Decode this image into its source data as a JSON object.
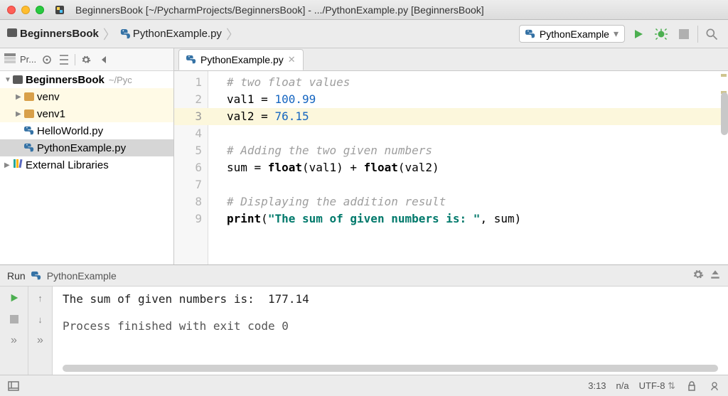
{
  "window": {
    "title": "BeginnersBook [~/PycharmProjects/BeginnersBook] - .../PythonExample.py [BeginnersBook]"
  },
  "breadcrumb": {
    "project": "BeginnersBook",
    "file": "PythonExample.py"
  },
  "runconfig": {
    "name": "PythonExample"
  },
  "sidebar": {
    "tool_label": "Pr...",
    "root_name": "BeginnersBook",
    "root_path": "~/Pyc",
    "items": [
      {
        "label": "venv",
        "type": "folder",
        "highlight": true
      },
      {
        "label": "venv1",
        "type": "folder",
        "highlight": true
      },
      {
        "label": "HelloWorld.py",
        "type": "py",
        "highlight": false
      },
      {
        "label": "PythonExample.py",
        "type": "py",
        "highlight": false,
        "selected": true
      }
    ],
    "external_label": "External Libraries"
  },
  "editor": {
    "tab": "PythonExample.py",
    "lines": [
      {
        "n": 1,
        "segs": [
          {
            "t": "# two float values",
            "c": "c-comment"
          }
        ]
      },
      {
        "n": 2,
        "segs": [
          {
            "t": "val1 = "
          },
          {
            "t": "100.99",
            "c": "c-num"
          }
        ]
      },
      {
        "n": 3,
        "hl": true,
        "segs": [
          {
            "t": "val2 = "
          },
          {
            "t": "76.15",
            "c": "c-num"
          }
        ]
      },
      {
        "n": 4,
        "segs": [
          {
            "t": ""
          }
        ]
      },
      {
        "n": 5,
        "segs": [
          {
            "t": "# Adding the two given numbers",
            "c": "c-comment"
          }
        ]
      },
      {
        "n": 6,
        "segs": [
          {
            "t": "sum = "
          },
          {
            "t": "float",
            "c": "c-fn"
          },
          {
            "t": "(val1) + "
          },
          {
            "t": "float",
            "c": "c-fn"
          },
          {
            "t": "(val2)"
          }
        ]
      },
      {
        "n": 7,
        "segs": [
          {
            "t": ""
          }
        ]
      },
      {
        "n": 8,
        "segs": [
          {
            "t": "# Displaying the addition result",
            "c": "c-comment"
          }
        ]
      },
      {
        "n": 9,
        "segs": [
          {
            "t": "print",
            "c": "c-fn"
          },
          {
            "t": "("
          },
          {
            "t": "\"The sum of given numbers is: \"",
            "c": "c-str"
          },
          {
            "t": ", sum)"
          }
        ]
      }
    ]
  },
  "run": {
    "tab_label": "Run",
    "config_name": "PythonExample",
    "output_line": "The sum of given numbers is:  177.14",
    "exit_line": "Process finished with exit code 0"
  },
  "status": {
    "pos": "3:13",
    "insp": "n/a",
    "encoding": "UTF-8"
  }
}
